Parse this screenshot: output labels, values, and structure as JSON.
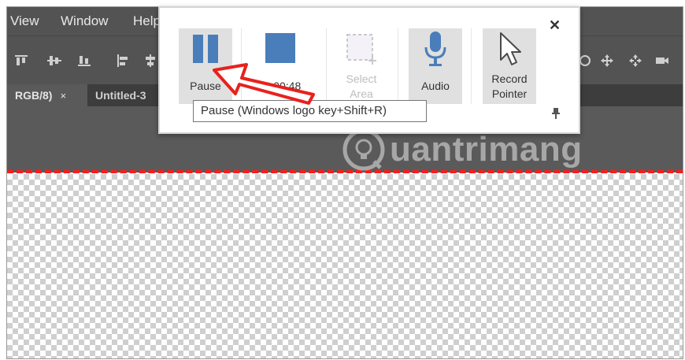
{
  "menubar": {
    "items": [
      "View",
      "Window",
      "Help"
    ]
  },
  "tabs": [
    {
      "label": "RGB/8)",
      "close": "×"
    },
    {
      "label": "Untitled-3"
    }
  ],
  "recorder": {
    "pause": {
      "label": "Pause"
    },
    "timer": {
      "label": "00:00:48"
    },
    "select_area": {
      "label_line1": "Select",
      "label_line2": "Area"
    },
    "audio": {
      "label": "Audio"
    },
    "record_pointer": {
      "label_line1": "Record",
      "label_line2": "Pointer"
    },
    "close_glyph": "✕"
  },
  "tooltip": {
    "text": "Pause (Windows logo key+Shift+R)"
  },
  "watermark": {
    "text": "uantrimang"
  },
  "colors": {
    "accent_blue": "#4a7ebb",
    "annotation_red": "#ff1a1a",
    "app_gray": "#535353"
  }
}
